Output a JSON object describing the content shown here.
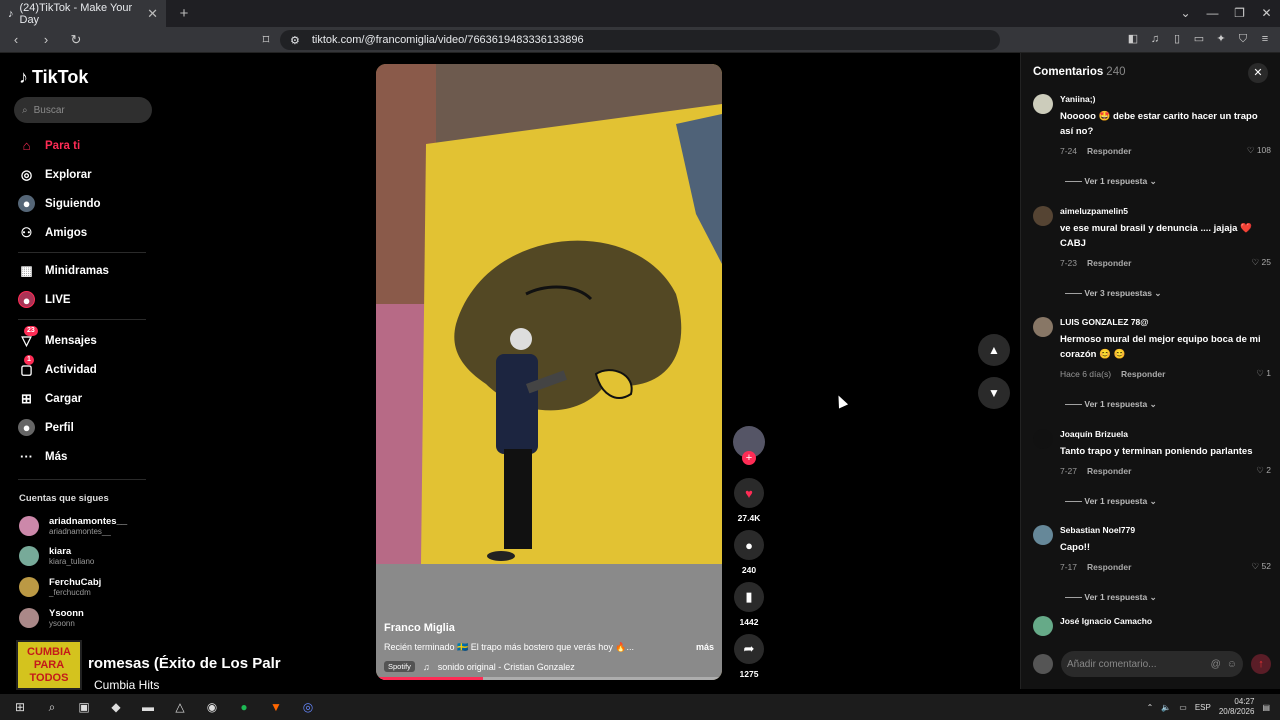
{
  "browser": {
    "tab_title": "(24)TikTok - Make Your Day",
    "url": "tiktok.com/@francomiglia/video/7663619483336133896"
  },
  "sidebar": {
    "logo": "TikTok",
    "search_placeholder": "Buscar",
    "nav": [
      {
        "label": "Para ti"
      },
      {
        "label": "Explorar"
      },
      {
        "label": "Siguiendo"
      },
      {
        "label": "Amigos"
      },
      {
        "label": "Minidramas"
      },
      {
        "label": "LIVE"
      },
      {
        "label": "Mensajes",
        "badge": "23"
      },
      {
        "label": "Actividad",
        "badge": "1"
      },
      {
        "label": "Cargar"
      },
      {
        "label": "Perfil"
      },
      {
        "label": "Más"
      }
    ],
    "following_title": "Cuentas que sigues",
    "following": [
      {
        "name": "ariadnamontes__",
        "handle": "ariadnamontes__"
      },
      {
        "name": "kiara",
        "handle": "kiara_tuliano"
      },
      {
        "name": "FerchuCabj",
        "handle": "_ferchucdm"
      },
      {
        "name": "Ysoonn",
        "handle": "ysoonn"
      }
    ]
  },
  "video": {
    "author": "Franco Miglia",
    "description": "Recién terminado 🇸🇪 El trapo más bostero que verás hoy 🔥...",
    "more_label": "más",
    "chip": "Spotify",
    "sound": "sonido original - Cristian Gonzalez",
    "progress": 0.31
  },
  "actions": {
    "likes": "27.4K",
    "comments": "240",
    "saves": "1442",
    "shares": "1275"
  },
  "comments_panel": {
    "title": "Comentarios",
    "count": "240",
    "input_placeholder": "Añadir comentario...",
    "reply_label": "Responder",
    "items": [
      {
        "user": "Yaniina;)",
        "text": "Nooooo 🤩 debe estar carito hacer un trapo así no?",
        "date": "7-24",
        "likes": "108",
        "replies": "Ver 1 respuesta"
      },
      {
        "user": "aimeluzpamelin5",
        "text": "ve ese mural brasil y denuncia .... jajaja ❤️CABJ",
        "date": "7-23",
        "likes": "25",
        "replies": "Ver 3 respuestas"
      },
      {
        "user": "LUIS GONZALEZ 78@",
        "text": "Hermoso mural del mejor equipo boca de mi corazón 😊 😊",
        "date": "Hace 6 día(s)",
        "likes": "1",
        "replies": "Ver 1 respuesta"
      },
      {
        "user": "Joaquín Brizuela",
        "text": "Tanto trapo y terminan poniendo parlantes",
        "date": "7-27",
        "likes": "2",
        "replies": "Ver 1 respuesta"
      },
      {
        "user": "Sebastian Noel779",
        "text": "Capo!!",
        "date": "7-17",
        "likes": "52",
        "replies": "Ver 1 respuesta"
      },
      {
        "user": "José Ignacio Camacho",
        "text": "",
        "date": "",
        "likes": "",
        "replies": ""
      }
    ]
  },
  "spotify_overlay": {
    "art_text": "CUMBIA PARA TODOS",
    "track": "romesas (Éxito de Los Palr",
    "playlist": "Cumbia Hits"
  },
  "taskbar": {
    "lang": "ESP",
    "time": "04:27",
    "date": "20/8/2026"
  },
  "colors": {
    "accent": "#fe2c55",
    "bg": "#000000",
    "panel": "#121212"
  }
}
